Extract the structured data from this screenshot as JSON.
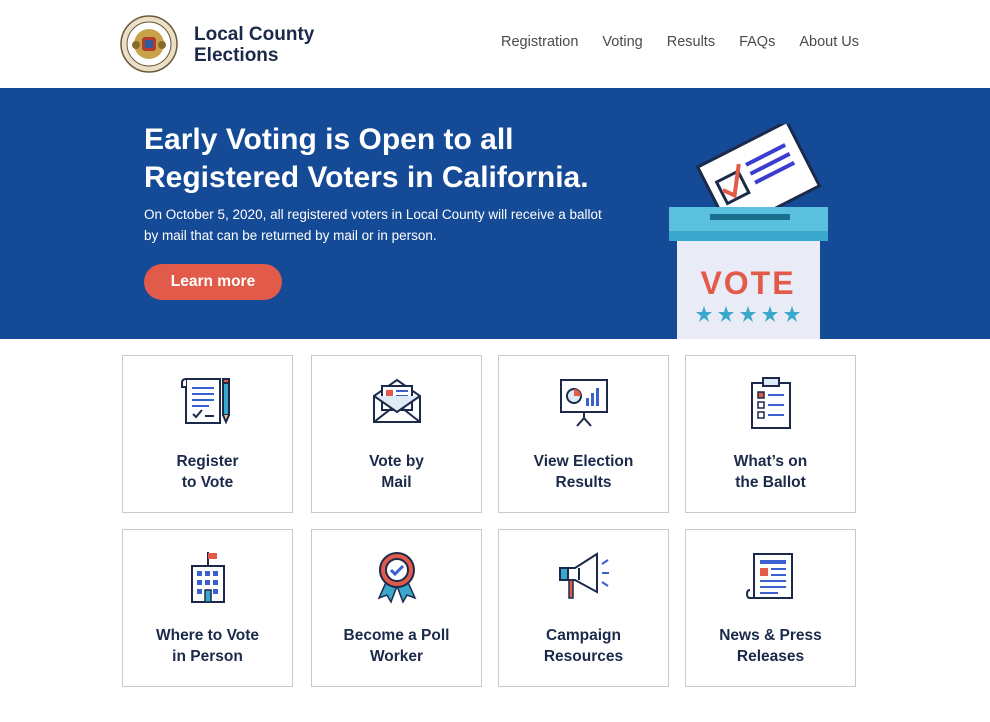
{
  "header": {
    "logo_line1": "Local County",
    "logo_line2": "Elections",
    "seal_icon": "state-seal-icon",
    "nav": [
      "Registration",
      "Voting",
      "Results",
      "FAQs",
      "About Us"
    ]
  },
  "hero": {
    "title": "Early Voting is Open to all Registered Voters in California.",
    "subtitle": "On October 5, 2020, all registered voters in Local County will receive a ballot by mail that can be returned by mail or in person.",
    "button_label": "Learn more",
    "art_text": "VOTE",
    "colors": {
      "background": "#154a96",
      "button": "#e25a4a",
      "box": "#5bc0de"
    }
  },
  "cards": [
    {
      "line1": "Register",
      "line2": "to Vote",
      "icon": "document-pencil-icon"
    },
    {
      "line1": "Vote by",
      "line2": "Mail",
      "icon": "envelope-icon"
    },
    {
      "line1": "View Election",
      "line2": "Results",
      "icon": "presentation-chart-icon"
    },
    {
      "line1": "What’s on",
      "line2": "the Ballot",
      "icon": "clipboard-checklist-icon"
    },
    {
      "line1": "Where to Vote",
      "line2": "in Person",
      "icon": "building-flag-icon"
    },
    {
      "line1": "Become a Poll",
      "line2": "Worker",
      "icon": "award-ribbon-icon"
    },
    {
      "line1": "Campaign",
      "line2": "Resources",
      "icon": "megaphone-icon"
    },
    {
      "line1": "News & Press",
      "line2": "Releases",
      "icon": "newspaper-icon"
    }
  ]
}
